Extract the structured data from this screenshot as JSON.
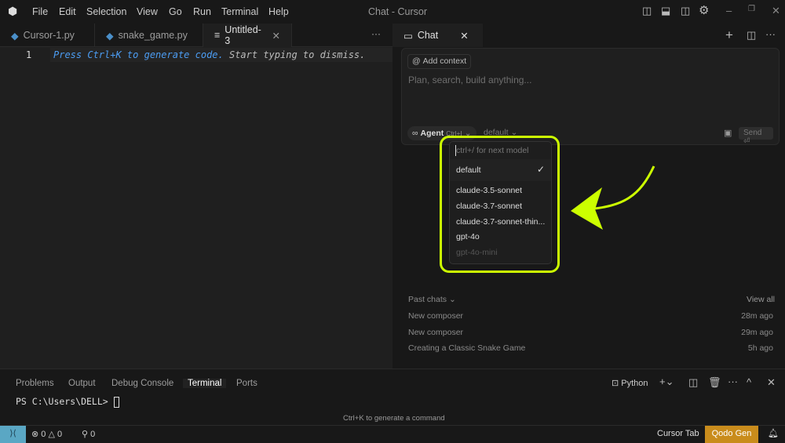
{
  "window": {
    "title": "Chat - Cursor",
    "menu": [
      "File",
      "Edit",
      "Selection",
      "View",
      "Go",
      "Run",
      "Terminal",
      "Help"
    ]
  },
  "editor": {
    "tabs": [
      {
        "label": "Cursor-1.py"
      },
      {
        "label": "snake_game.py"
      },
      {
        "label": "Untitled-3"
      }
    ],
    "line_number": "1",
    "hint_action": "Press Ctrl+K to generate code.",
    "hint_dismiss": "Start typing to dismiss."
  },
  "chat": {
    "tab_label": "Chat",
    "add_context": "Add context",
    "placeholder": "Plan, search, build anything...",
    "mode": "Agent",
    "mode_shortcut": "Ctrl+I",
    "model": "default",
    "send": "Send",
    "model_menu": {
      "search_placeholder": "ctrl+/ for next model",
      "selected": "default",
      "items": [
        "default",
        "claude-3.5-sonnet",
        "claude-3.7-sonnet",
        "claude-3.7-sonnet-thin...",
        "gpt-4o",
        "gpt-4o-mini"
      ]
    },
    "past_chats": {
      "label": "Past chats",
      "view_all": "View all",
      "items": [
        {
          "title": "New composer",
          "time": "28m ago"
        },
        {
          "title": "New composer",
          "time": "29m ago"
        },
        {
          "title": "Creating a Classic Snake Game",
          "time": "5h ago"
        }
      ]
    }
  },
  "panel": {
    "tabs": [
      "Problems",
      "Output",
      "Debug Console",
      "Terminal",
      "Ports"
    ],
    "active": "Terminal",
    "shell": "Python",
    "prompt": "PS C:\\Users\\DELL>",
    "hint": "Ctrl+K to generate a command"
  },
  "status": {
    "errors": "0",
    "warnings": "0",
    "ports": "0",
    "cursor_tab": "Cursor Tab",
    "qodo": "Qodo Gen"
  },
  "colors": {
    "highlight": "#ccff00",
    "qodo_bg": "#c98c1c",
    "remote_bg": "#5aa7c4",
    "hint_blue": "#4c9df3"
  }
}
